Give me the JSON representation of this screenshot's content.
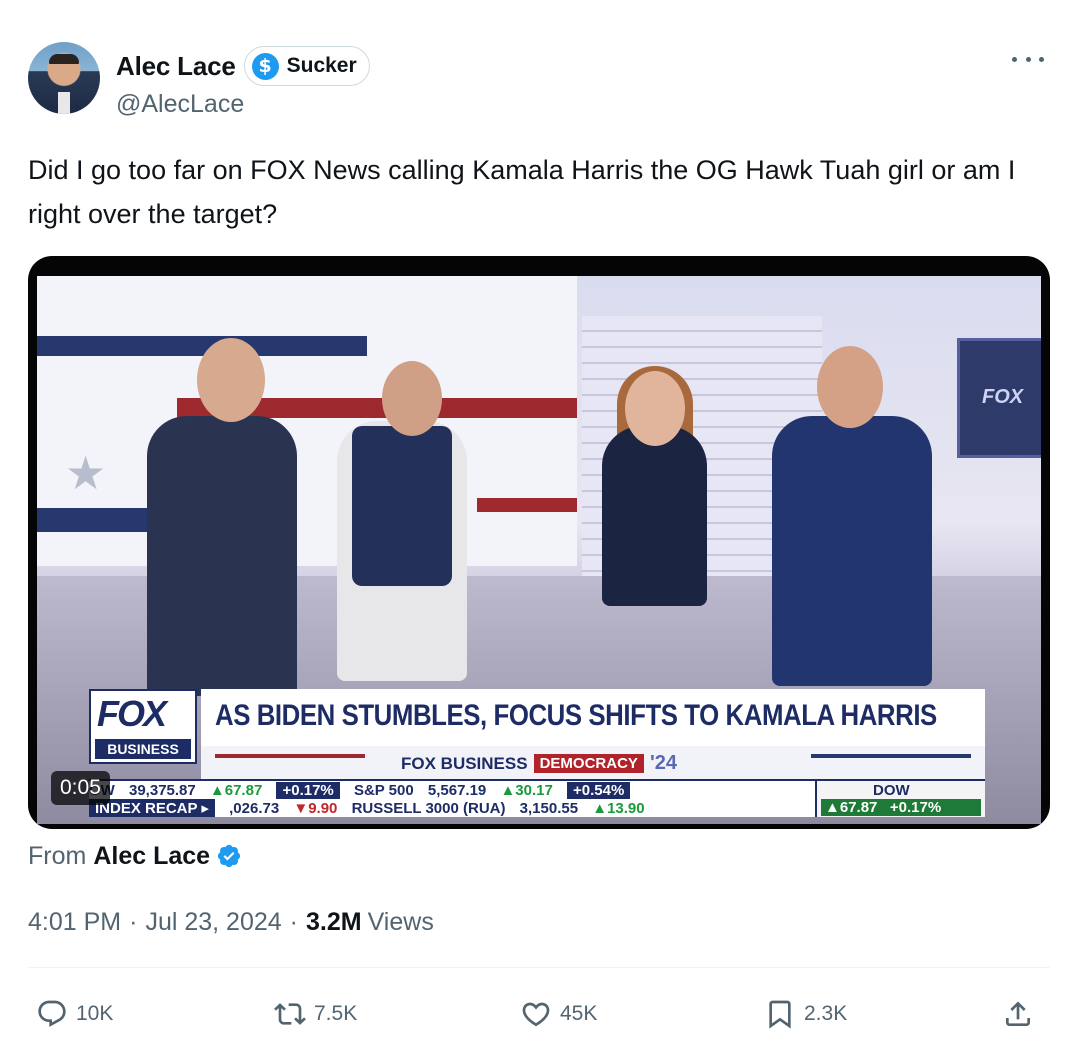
{
  "author": {
    "display_name": "Alec Lace",
    "badge_label": "Sucker",
    "badge_icon": "dollar-sign-icon",
    "handle": "@AlecLace"
  },
  "tweet": {
    "text": "Did I go too far on FOX News calling Kamala Harris the OG Hawk Tuah girl or am I right over the target?"
  },
  "video": {
    "duration": "0:05",
    "broadcast": {
      "logo_top": "FOX",
      "logo_bottom": "BUSINESS",
      "headline": "AS BIDEN STUMBLES, FOCUS SHIFTS TO KAMALA HARRIS",
      "brand_left": "FOX BUSINESS",
      "brand_tag": "DEMOCRACY",
      "brand_year": "'24",
      "studio_screen_label": "FOX",
      "ticker_row1": [
        "OW",
        "39,375.87",
        "▲67.87",
        "+0.17%",
        "S&P 500",
        "5,567.19",
        "▲30.17",
        "+0.54%"
      ],
      "ticker_row2": [
        "INDEX RECAP ▸",
        ",026.73",
        "▼9.90",
        "RUSSELL 3000 (RUA)",
        "3,150.55",
        "▲13.90"
      ],
      "dow_label": "DOW",
      "dow_change": "▲67.87",
      "dow_pct": "+0.17%"
    }
  },
  "attribution": {
    "prefix": "From",
    "name": "Alec Lace"
  },
  "meta": {
    "time": "4:01 PM",
    "separator": "·",
    "date": "Jul 23, 2024",
    "views_count": "3.2M",
    "views_label": "Views"
  },
  "actions": {
    "replies": "10K",
    "reposts": "7.5K",
    "likes": "45K",
    "bookmarks": "2.3K"
  },
  "colors": {
    "accent": "#1d9bf0",
    "text_primary": "#0f1419",
    "text_secondary": "#536471"
  }
}
